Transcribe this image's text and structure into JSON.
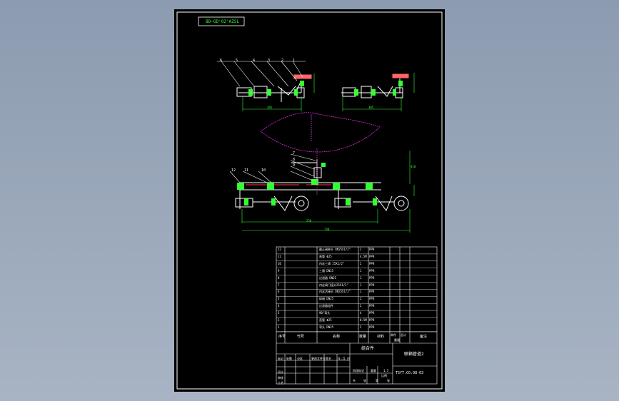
{
  "drawing_no_box": "BD-GD'02'AZSL",
  "balloons": [
    "1",
    "2",
    "3",
    "4",
    "5",
    "6",
    "7",
    "8",
    "9",
    "10",
    "11",
    "12"
  ],
  "dims": {
    "top_left": "305",
    "top_right": "305",
    "height": "410",
    "mid": "230",
    "bottom": "730"
  },
  "bom": {
    "rows": [
      {
        "no": "12",
        "name": "截止阀单头 DN25X1/2\"",
        "qty": "2",
        "mat": "PPR"
      },
      {
        "no": "11",
        "name": "直管 Φ25",
        "qty": "4.5M",
        "mat": "PPR"
      },
      {
        "no": "10",
        "name": "内丝三通 25X1/2\"",
        "qty": "2",
        "mat": "PPR"
      },
      {
        "no": "9",
        "name": "三通 DN25",
        "qty": "1",
        "mat": "PPR"
      },
      {
        "no": "8",
        "name": "过滤器 DN25",
        "qty": "1",
        "mat": "PPR"
      },
      {
        "no": "7",
        "name": "内丝阀门接头25X1/2\"",
        "qty": "1",
        "mat": "PPR"
      },
      {
        "no": "6",
        "name": "内丝活接头 DN25X1/2\"",
        "qty": "2",
        "mat": "PPR"
      },
      {
        "no": "5",
        "name": "球阀 DN25",
        "qty": "2",
        "mat": "PPR"
      },
      {
        "no": "4",
        "name": "过滤器组件",
        "qty": "2",
        "mat": "PPR"
      },
      {
        "no": "3",
        "name": "90°弯头",
        "qty": "4",
        "mat": "PPR"
      },
      {
        "no": "2",
        "name": "直管 Φ25",
        "qty": "0.5M",
        "mat": "PPR"
      },
      {
        "no": "1",
        "name": "弯头 DN25",
        "qty": "2",
        "mat": "PPR"
      }
    ],
    "header": {
      "no": "序号",
      "code": "代号",
      "name": "名称",
      "qty": "数量",
      "mat": "材料",
      "single": "单件",
      "total": "总计",
      "weight": "重量",
      "remark": "备注"
    }
  },
  "title_block": {
    "assembly": "组合件",
    "drawing_name": "联箱管道2",
    "drawing_code": "TSYT.CO.08-03",
    "scale": "1:5",
    "labels": [
      "标记",
      "处数",
      "分区",
      "更改文件号",
      "签名",
      "年.月.日",
      "设计",
      "审核",
      "工艺",
      "阶段标记",
      "重量",
      "比例",
      "共",
      "张",
      "第",
      "张"
    ]
  }
}
